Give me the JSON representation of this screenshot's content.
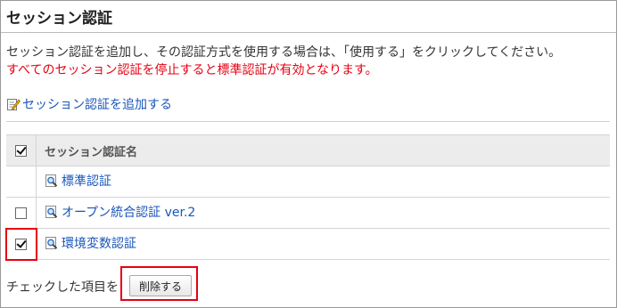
{
  "page": {
    "title": "セッション認証",
    "description": "セッション認証を追加し、その認証方式を使用する場合は、「使用する」をクリックしてください。",
    "warning": "すべてのセッション認証を停止すると標準認証が有効となります。",
    "add_link": "セッション認証を追加する"
  },
  "table": {
    "header": "セッション認証名",
    "rows": [
      {
        "label": "標準認証",
        "has_checkbox": false,
        "checked": false
      },
      {
        "label": "オープン統合認証 ver.2",
        "has_checkbox": true,
        "checked": false
      },
      {
        "label": "環境変数認証",
        "has_checkbox": true,
        "checked": true
      }
    ]
  },
  "footer": {
    "checked_label": "チェックした項目を",
    "delete_button": "削除する"
  },
  "colors": {
    "link": "#1a56b8",
    "warning": "#e60012",
    "highlight": "#e60012"
  },
  "icons": {
    "add": "edit-icon",
    "row": "magnifier-icon"
  }
}
